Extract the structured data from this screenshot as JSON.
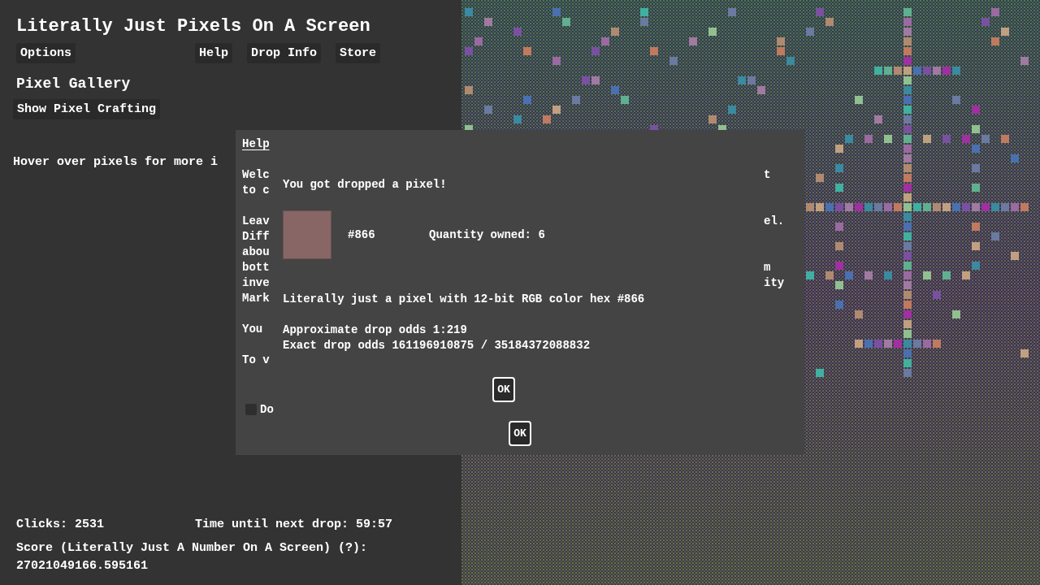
{
  "title": "Literally Just Pixels On A Screen",
  "menu_left": [
    "Options"
  ],
  "menu_right": [
    "Help",
    "Drop Info",
    "Store"
  ],
  "gallery_heading": "Pixel Gallery",
  "crafting_button": "Show Pixel Crafting",
  "hover_hint": "Hover over pixels for more i",
  "stats": {
    "clicks": "Clicks: 2531",
    "timer": "Time until next drop: 59:57",
    "score_label": "Score (Literally Just A Number On A Screen) (?):",
    "score_value": "27021049166.595161"
  },
  "help": {
    "title": "Help",
    "paragraphs": [
      [
        {
          "left": "Welc",
          "right": "t"
        },
        {
          "left": "to c"
        }
      ],
      [
        {
          "left": "Leav",
          "right": "el."
        },
        {
          "left": "Diff"
        },
        {
          "left": "abou"
        },
        {
          "left": "bott",
          "right": "m"
        },
        {
          "left": "inve",
          "right": "ity"
        },
        {
          "left": "Mark"
        }
      ],
      [
        {
          "left": "You"
        }
      ],
      [
        {
          "left": "To v"
        }
      ]
    ],
    "dont_show": {
      "label": "Do",
      "checked": false
    },
    "ok": "OK"
  },
  "drop": {
    "title": "You got dropped a pixel!",
    "color": "#886666",
    "hex": "#866",
    "quantity": "Quantity owned: 6",
    "description": "Literally just a pixel with 12-bit RGB color hex #866",
    "approx": "Approximate drop odds 1:219",
    "exact": "Exact drop odds 161196910875 / 35184372088832",
    "ok": "OK"
  }
}
